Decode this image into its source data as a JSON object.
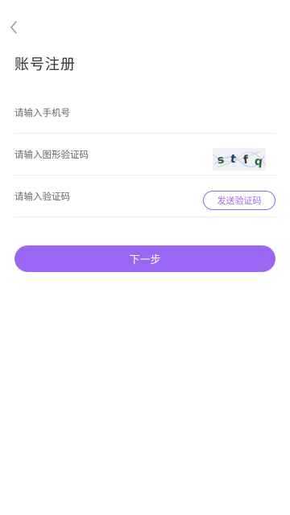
{
  "header": {
    "back_icon": "chevron-left-icon",
    "title": "账号注册"
  },
  "form": {
    "phone_placeholder": "请输入手机号",
    "captcha_placeholder": "请输入图形验证码",
    "captcha_text": "s t f q",
    "sms_placeholder": "请输入验证码",
    "send_code_label": "发送验证码"
  },
  "actions": {
    "next_label": "下一步"
  },
  "colors": {
    "accent": "#9b66f3",
    "text": "#333333",
    "placeholder": "#666666",
    "divider": "#ececec"
  }
}
